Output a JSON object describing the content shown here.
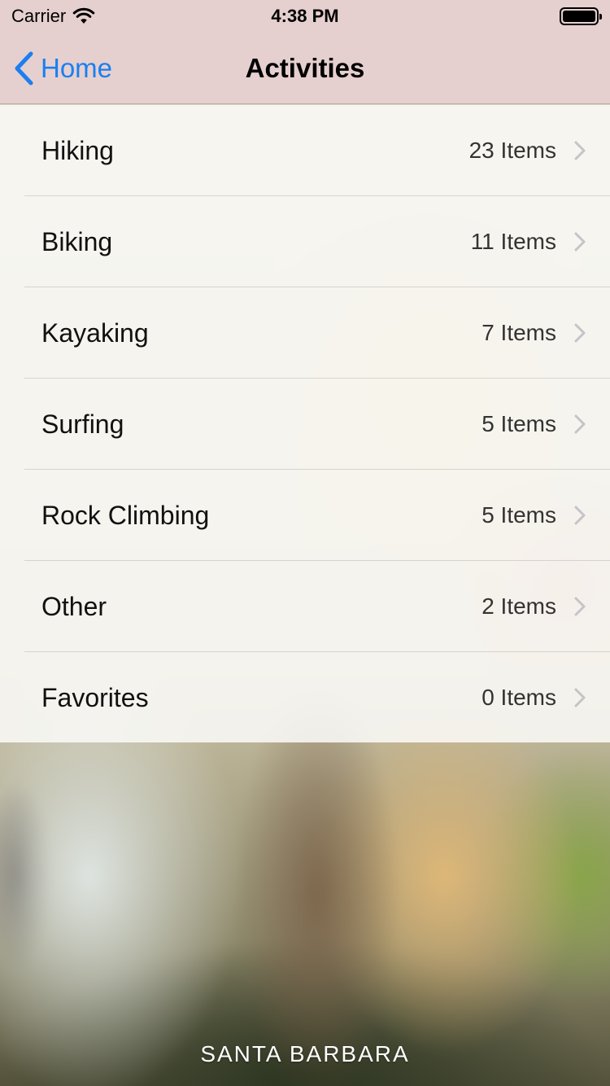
{
  "status_bar": {
    "carrier": "Carrier",
    "time": "4:38 PM",
    "icons": [
      "wifi-icon",
      "battery-icon"
    ]
  },
  "nav": {
    "back_label": "Home",
    "back_icon": "chevron-left-icon",
    "title": "Activities",
    "accent_color": "#1b7ff0"
  },
  "activities": [
    {
      "title": "Hiking",
      "detail": "23 Items"
    },
    {
      "title": "Biking",
      "detail": "11 Items"
    },
    {
      "title": "Kayaking",
      "detail": "7 Items"
    },
    {
      "title": "Surfing",
      "detail": "5 Items"
    },
    {
      "title": "Rock Climbing",
      "detail": "5 Items"
    },
    {
      "title": "Other",
      "detail": "2 Items"
    },
    {
      "title": "Favorites",
      "detail": "0 Items"
    }
  ],
  "footer": {
    "caption": "SANTA BARBARA"
  }
}
